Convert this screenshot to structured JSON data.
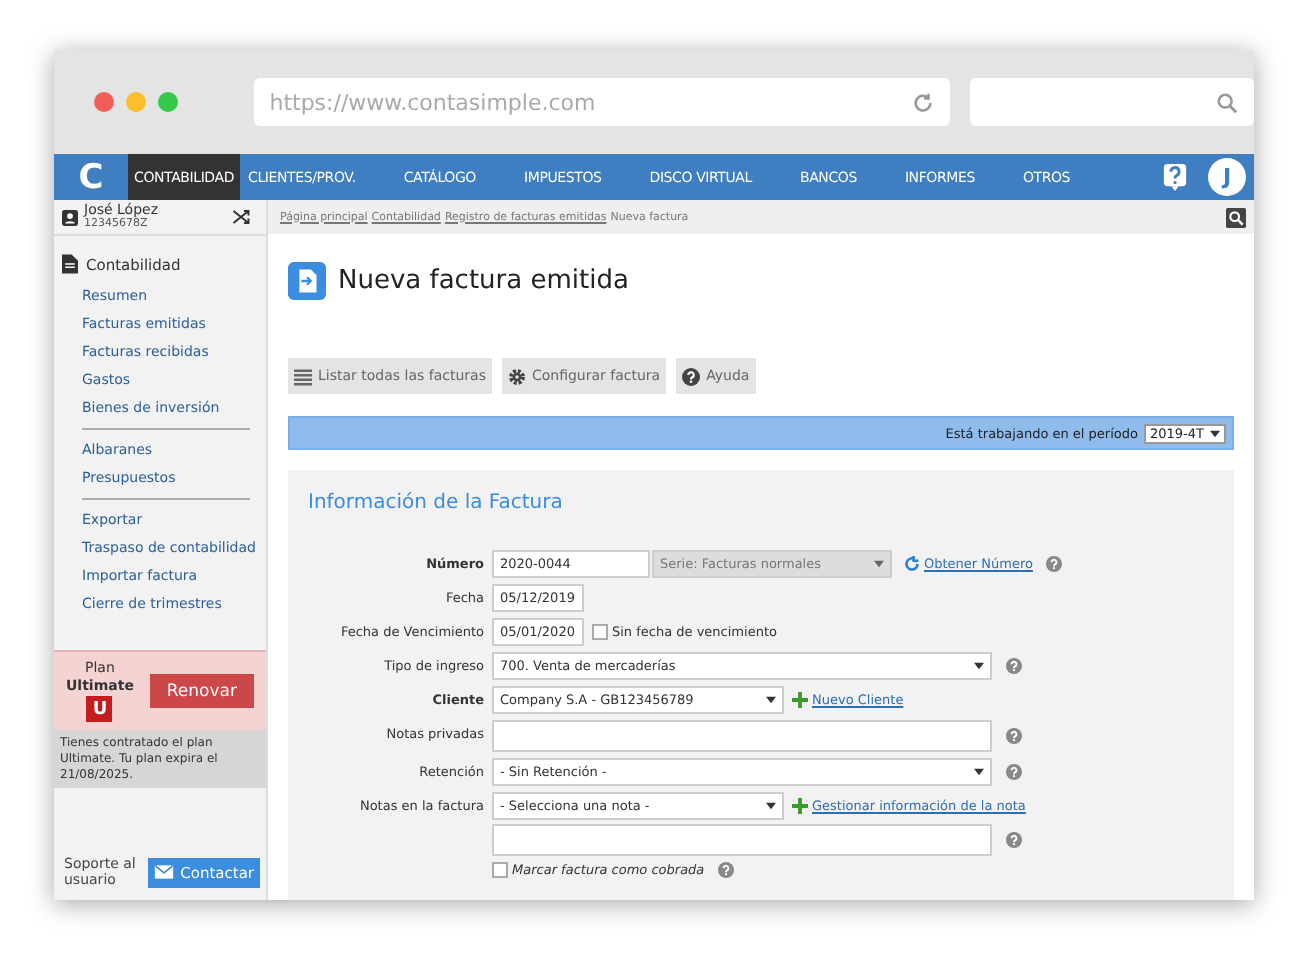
{
  "browser": {
    "url": "https://www.contasimple.com"
  },
  "nav": {
    "logo": "C",
    "items": [
      {
        "label": "CONTABILIDAD",
        "selected": true
      },
      {
        "label": "CLIENTES/PROV.",
        "selected": false
      },
      {
        "label": "CATÁLOGO",
        "selected": false
      },
      {
        "label": "IMPUESTOS",
        "selected": false
      },
      {
        "label": "DISCO VIRTUAL",
        "selected": false
      },
      {
        "label": "BANCOS",
        "selected": false
      },
      {
        "label": "INFORMES",
        "selected": false
      },
      {
        "label": "OTROS",
        "selected": false
      }
    ],
    "avatar": "J"
  },
  "user": {
    "name": "José López",
    "id": "12345678Z"
  },
  "breadcrumb": [
    {
      "label": "Página principal",
      "link": true
    },
    {
      "label": "Contabilidad",
      "link": true
    },
    {
      "label": "Registro de facturas emitidas",
      "link": true
    },
    {
      "label": "Nueva factura",
      "link": false
    }
  ],
  "sidebar": {
    "title": "Contabilidad",
    "groups": [
      [
        "Resumen",
        "Facturas emitidas",
        "Facturas recibidas",
        "Gastos",
        "Bienes de inversión"
      ],
      [
        "Albaranes",
        "Presupuestos"
      ],
      [
        "Exportar",
        "Traspaso de contabilidad",
        "Importar factura",
        "Cierre de trimestres"
      ]
    ],
    "plan": {
      "label": "Plan",
      "name": "Ultimate",
      "badge": "U",
      "button": "Renovar",
      "note": "Tienes contratado el plan Ultimate. Tu plan expira el 21/08/2025."
    },
    "support": {
      "label": "Soporte al usuario",
      "button": "Contactar"
    }
  },
  "page_title": "Nueva factura emitida",
  "toolbar": [
    {
      "kind": "list",
      "label": "Listar todas las facturas"
    },
    {
      "kind": "gear",
      "label": "Configurar factura"
    },
    {
      "kind": "help",
      "label": "Ayuda"
    }
  ],
  "period": {
    "label": "Está trabajando en el período",
    "value": "2019-4T"
  },
  "form": {
    "title": "Información de la Factura",
    "rows": [
      {
        "kind": "number",
        "label": "Número",
        "bold": true,
        "value": "2020-0044",
        "series": "Serie: Facturas normales",
        "link": "Obtener Número",
        "help": true
      },
      {
        "kind": "date",
        "label": "Fecha",
        "bold": false,
        "value": "05/12/2019",
        "help": false
      },
      {
        "kind": "date_check",
        "label": "Fecha de Vencimiento",
        "bold": false,
        "value": "05/01/2020",
        "check_label": "Sin fecha de vencimiento",
        "checked": false,
        "help": false
      },
      {
        "kind": "select",
        "label": "Tipo de ingreso",
        "bold": false,
        "value": "700. Venta de mercaderías",
        "help": true
      },
      {
        "kind": "select_link",
        "label": "Cliente",
        "bold": true,
        "value": "Company S.A - GB123456789",
        "link": "Nuevo Cliente",
        "help": false
      },
      {
        "kind": "textarea",
        "label": "Notas privadas",
        "bold": false,
        "help": true
      },
      {
        "kind": "select",
        "label": "Retención",
        "bold": false,
        "value": "- Sin Retención -",
        "help": true
      },
      {
        "kind": "select_link_textarea",
        "label": "Notas en la factura",
        "bold": false,
        "value": "- Selecciona una nota -",
        "link": "Gestionar información de la nota",
        "help": true
      }
    ],
    "paid": {
      "label": "Marcar factura como cobrada",
      "checked": false,
      "help": true
    }
  }
}
